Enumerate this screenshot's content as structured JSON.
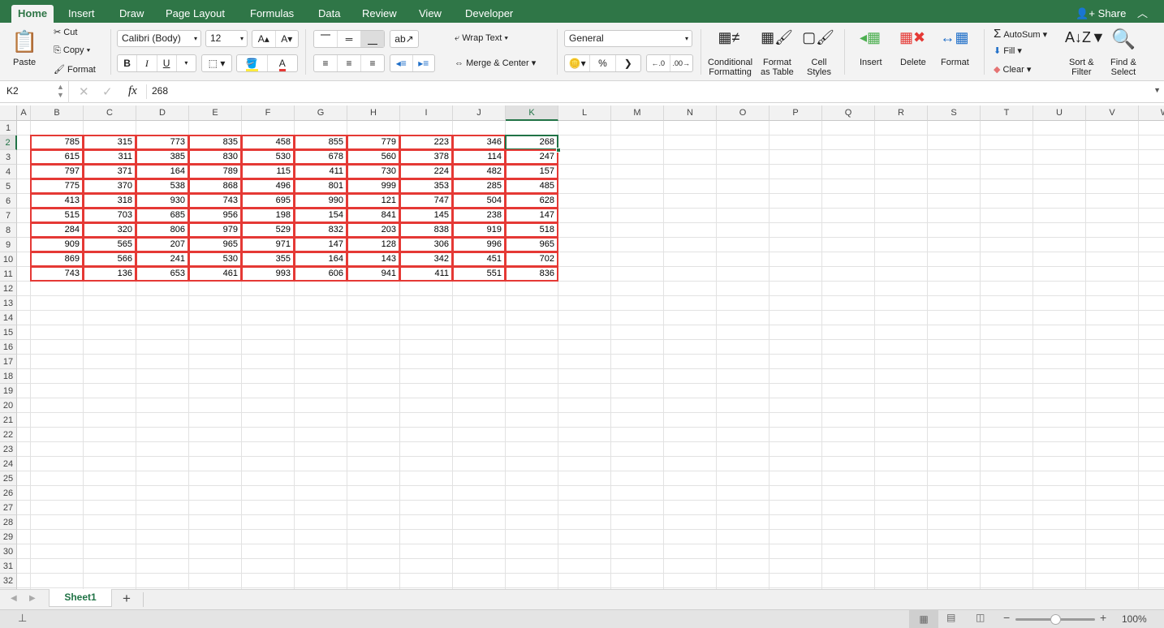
{
  "tabs": [
    {
      "label": "Home",
      "active": true
    },
    {
      "label": "Insert"
    },
    {
      "label": "Draw"
    },
    {
      "label": "Page Layout"
    },
    {
      "label": "Formulas"
    },
    {
      "label": "Data"
    },
    {
      "label": "Review"
    },
    {
      "label": "View"
    },
    {
      "label": "Developer"
    }
  ],
  "share_label": "Share",
  "ribbon": {
    "paste": "Paste",
    "cut": "Cut",
    "copy": "Copy",
    "format_painter": "Format",
    "font_name": "Calibri (Body)",
    "font_size": "12",
    "bold": "B",
    "italic": "I",
    "underline": "U",
    "wrap_text": "Wrap Text",
    "merge_center": "Merge & Center",
    "number_format": "General",
    "percent": "%",
    "comma": "❯",
    "conditional_formatting": [
      "Conditional",
      "Formatting"
    ],
    "format_as_table": [
      "Format",
      "as Table"
    ],
    "cell_styles": [
      "Cell",
      "Styles"
    ],
    "insert": "Insert",
    "delete": "Delete",
    "format": "Format",
    "autosum": "AutoSum",
    "fill": "Fill",
    "clear": "Clear",
    "sort_filter": [
      "Sort &",
      "Filter"
    ],
    "find_select": [
      "Find &",
      "Select"
    ]
  },
  "formula_bar": {
    "name_box": "K2",
    "fx": "fx",
    "value": "268"
  },
  "columns": [
    "A",
    "B",
    "C",
    "D",
    "E",
    "F",
    "G",
    "H",
    "I",
    "J",
    "K",
    "L",
    "M",
    "N",
    "O",
    "P",
    "Q",
    "R",
    "S",
    "T",
    "U",
    "V",
    "W"
  ],
  "selected_column": "K",
  "selected_row": 2,
  "rows_visible": 35,
  "data_start_row": 2,
  "data_start_col": "B",
  "table": [
    [
      785,
      315,
      773,
      835,
      458,
      855,
      779,
      223,
      346,
      268
    ],
    [
      615,
      311,
      385,
      830,
      530,
      678,
      560,
      378,
      114,
      247
    ],
    [
      797,
      371,
      164,
      789,
      115,
      411,
      730,
      224,
      482,
      157
    ],
    [
      775,
      370,
      538,
      868,
      496,
      801,
      999,
      353,
      285,
      485
    ],
    [
      413,
      318,
      930,
      743,
      695,
      990,
      121,
      747,
      504,
      628
    ],
    [
      515,
      703,
      685,
      956,
      198,
      154,
      841,
      145,
      238,
      147
    ],
    [
      284,
      320,
      806,
      979,
      529,
      832,
      203,
      838,
      919,
      518
    ],
    [
      909,
      565,
      207,
      965,
      971,
      147,
      128,
      306,
      996,
      965
    ],
    [
      869,
      566,
      241,
      530,
      355,
      164,
      143,
      342,
      451,
      702
    ],
    [
      743,
      136,
      653,
      461,
      993,
      606,
      941,
      411,
      551,
      836
    ]
  ],
  "sheet_tabs": [
    {
      "label": "Sheet1",
      "active": true
    }
  ],
  "add_sheet": "+",
  "zoom_level": "100%",
  "zoom_fraction": 0.5,
  "colors": {
    "brand": "#2f7647",
    "cell_border": "#e53935",
    "selection": "#217346"
  }
}
